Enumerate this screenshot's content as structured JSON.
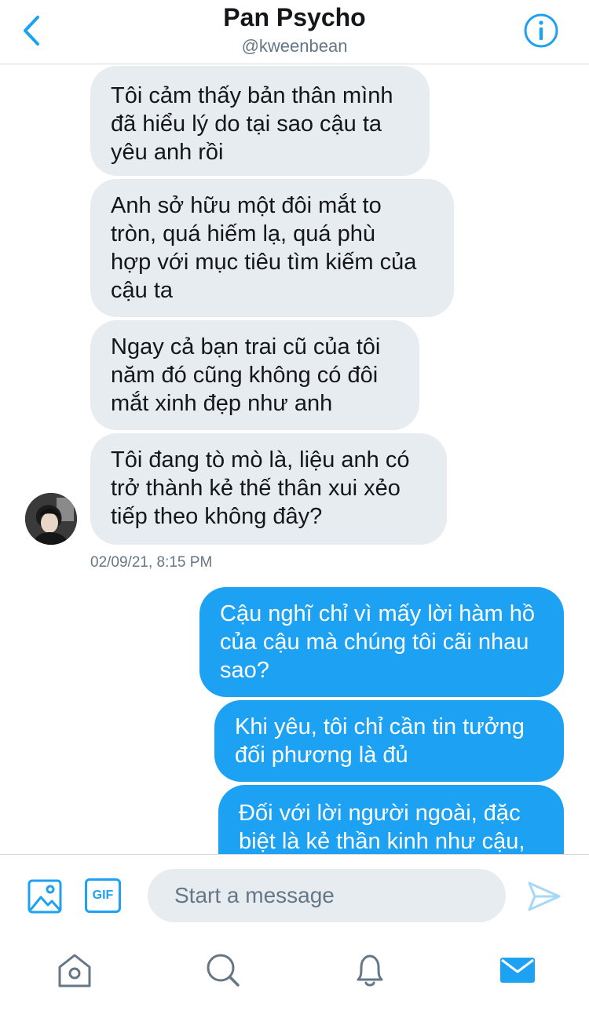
{
  "header": {
    "title": "Pan Psycho",
    "handle": "@kweenbean"
  },
  "messages": [
    {
      "direction": "in",
      "text": "Tôi cảm thấy bản thân mình\nđã hiểu lý do tại sao cậu ta\nyêu anh rồi"
    },
    {
      "direction": "in",
      "text": "Anh sở hữu một đôi mắt to\ntròn, quá hiếm lạ, quá phù\nhợp với mục tiêu tìm kiếm của\ncậu ta"
    },
    {
      "direction": "in",
      "text": "Ngay cả bạn trai cũ của tôi\nnăm đó cũng không có đôi\nmắt xinh đẹp như anh"
    },
    {
      "direction": "in",
      "text": "Tôi đang tò mò là, liệu anh có\ntrở thành kẻ thế thân xui xẻo\ntiếp theo không đây?"
    },
    {
      "direction": "out",
      "text": "Cậu nghĩ chỉ vì mấy lời hàm hồ\ncủa cậu mà chúng tôi cãi nhau\nsao?"
    },
    {
      "direction": "out",
      "text": "Khi yêu, tôi chỉ cần tin tưởng\nđối phương là đủ"
    },
    {
      "direction": "out",
      "text": "Đối với lời người ngoài, đặc\nbiệt là kẻ thần kinh như cậu,"
    }
  ],
  "timestamp": "02/09/21, 8:15 PM",
  "composer": {
    "gif_label": "GIF",
    "placeholder": "Start a message"
  },
  "icons": {
    "back": "chevron-left-icon",
    "info": "info-icon",
    "image": "image-icon",
    "send": "send-icon",
    "home": "home-icon",
    "search": "search-icon",
    "notifications": "bell-icon",
    "messages": "envelope-icon"
  },
  "colors": {
    "accent": "#1da1f2",
    "incoming_bubble": "#e6ecf0",
    "secondary_text": "#657786"
  }
}
